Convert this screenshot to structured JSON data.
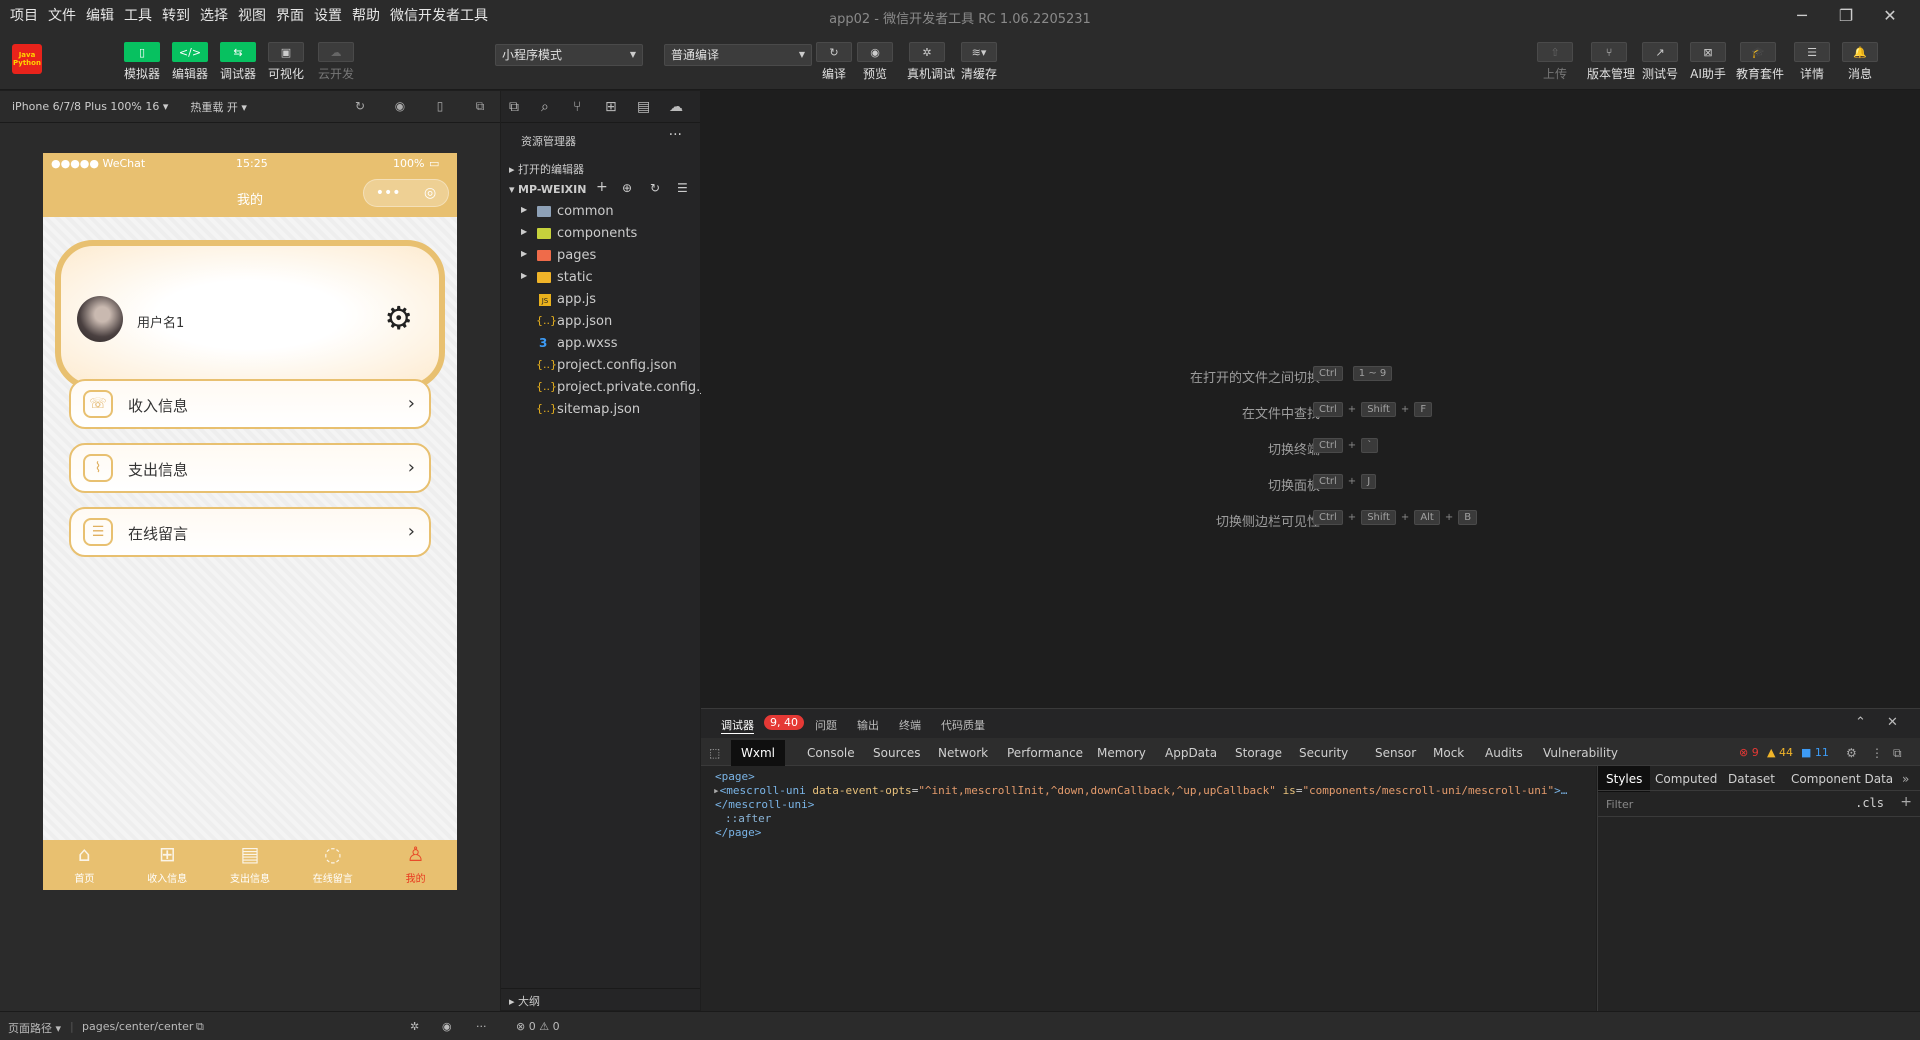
{
  "menubar": {
    "items": [
      "项目",
      "文件",
      "编辑",
      "工具",
      "转到",
      "选择",
      "视图",
      "界面",
      "设置",
      "帮助",
      "微信开发者工具"
    ],
    "title": "app02 - 微信开发者工具 RC 1.06.2205231"
  },
  "toolbar": {
    "logo_line1": "Java",
    "logo_line2": "Python",
    "buttons": {
      "simulator": "模拟器",
      "editor": "编辑器",
      "debugger": "调试器",
      "visual": "可视化",
      "cloud": "云开发",
      "compile": "编译",
      "preview": "预览",
      "remote_debug": "真机调试",
      "clear_cache": "清缓存",
      "upload": "上传",
      "version": "版本管理",
      "test_id": "测试号",
      "ai": "AI助手",
      "edu": "教育套件",
      "detail": "详情",
      "message": "消息"
    },
    "mode_select": "小程序模式",
    "compile_select": "普通编译"
  },
  "simulator": {
    "device": "iPhone 6/7/8 Plus 100% 16",
    "hot_reload": "热重载 开",
    "status": {
      "carrier": "●●●●● WeChat",
      "time": "15:25",
      "battery": "100%"
    },
    "nav_title": "我的",
    "username": "用户名1",
    "menu": [
      {
        "label": "收入信息",
        "icon": "phone-icon"
      },
      {
        "label": "支出信息",
        "icon": "chart-icon"
      },
      {
        "label": "在线留言",
        "icon": "chat-icon"
      }
    ],
    "tabs": [
      {
        "label": "首页",
        "icon": "home-icon"
      },
      {
        "label": "收入信息",
        "icon": "grid-icon"
      },
      {
        "label": "支出信息",
        "icon": "calendar-icon"
      },
      {
        "label": "在线留言",
        "icon": "chat-icon"
      },
      {
        "label": "我的",
        "icon": "user-icon"
      }
    ]
  },
  "explorer": {
    "header": "资源管理器",
    "open_editors": "打开的编辑器",
    "project": "MP-WEIXIN",
    "folders": [
      "common",
      "components",
      "pages",
      "static"
    ],
    "files": [
      "app.js",
      "app.json",
      "app.wxss",
      "project.config.json",
      "project.private.config.js...",
      "sitemap.json"
    ],
    "outline": "大纲"
  },
  "editor": {
    "shortcuts": [
      {
        "label": "在打开的文件之间切换",
        "keys": [
          "Ctrl",
          "1 ~ 9"
        ]
      },
      {
        "label": "在文件中查找",
        "keys": [
          "Ctrl",
          "Shift",
          "F"
        ]
      },
      {
        "label": "切换终端",
        "keys": [
          "Ctrl",
          "`"
        ]
      },
      {
        "label": "切换面板",
        "keys": [
          "Ctrl",
          "J"
        ]
      },
      {
        "label": "切换侧边栏可见性",
        "keys": [
          "Ctrl",
          "Shift",
          "Alt",
          "B"
        ]
      }
    ]
  },
  "debugger": {
    "head_tabs": [
      "调试器",
      "问题",
      "输出",
      "终端",
      "代码质量"
    ],
    "badge": "9, 40",
    "tabs": [
      "Wxml",
      "Console",
      "Sources",
      "Network",
      "Performance",
      "Memory",
      "AppData",
      "Storage",
      "Security",
      "Sensor",
      "Mock",
      "Audits",
      "Vulnerability"
    ],
    "errors": "9",
    "warnings": "44",
    "infos": "11",
    "wxml": {
      "line1": "<page>",
      "tag_open": "<mescroll-uni",
      "attr1": "data-event-opts",
      "val1": "\"^init,mescrollInit,^down,downCallback,^up,upCallback\"",
      "attr2": "is",
      "val2": "\"components/mescroll-uni/mescroll-uni\"",
      "tag_end": ">…",
      "line3": "</mescroll-uni>",
      "line4": "::after",
      "line5": "</page>"
    },
    "style_tabs": [
      "Styles",
      "Computed",
      "Dataset",
      "Component Data"
    ],
    "filter_placeholder": "Filter",
    "cls": ".cls"
  },
  "statusbar": {
    "page_path_label": "页面路径",
    "page_path": "pages/center/center",
    "problems": "⊗ 0 ⚠ 0"
  }
}
